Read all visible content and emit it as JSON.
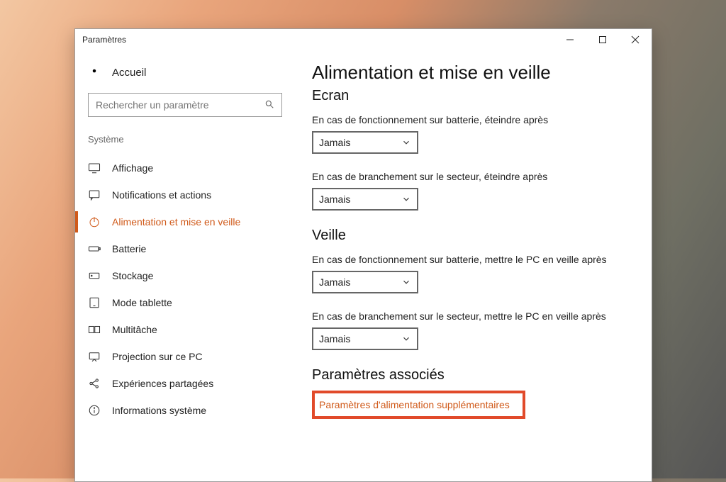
{
  "window": {
    "title": "Paramètres"
  },
  "sidebar": {
    "home": "Accueil",
    "search_placeholder": "Rechercher un paramètre",
    "section": "Système",
    "items": [
      {
        "label": "Affichage"
      },
      {
        "label": "Notifications et actions"
      },
      {
        "label": "Alimentation et mise en veille"
      },
      {
        "label": "Batterie"
      },
      {
        "label": "Stockage"
      },
      {
        "label": "Mode tablette"
      },
      {
        "label": "Multitâche"
      },
      {
        "label": "Projection sur ce PC"
      },
      {
        "label": "Expériences partagées"
      },
      {
        "label": "Informations système"
      }
    ]
  },
  "main": {
    "title": "Alimentation et mise en veille",
    "screen_h": "Ecran",
    "screen_batt_label": "En cas de fonctionnement sur batterie, éteindre après",
    "screen_batt_value": "Jamais",
    "screen_ac_label": "En cas de branchement sur le secteur, éteindre après",
    "screen_ac_value": "Jamais",
    "sleep_h": "Veille",
    "sleep_batt_label": "En cas de fonctionnement sur batterie, mettre le PC en veille après",
    "sleep_batt_value": "Jamais",
    "sleep_ac_label": "En cas de branchement sur le secteur, mettre le PC en veille après",
    "sleep_ac_value": "Jamais",
    "related_h": "Paramètres associés",
    "related_link": "Paramètres d'alimentation supplémentaires"
  }
}
